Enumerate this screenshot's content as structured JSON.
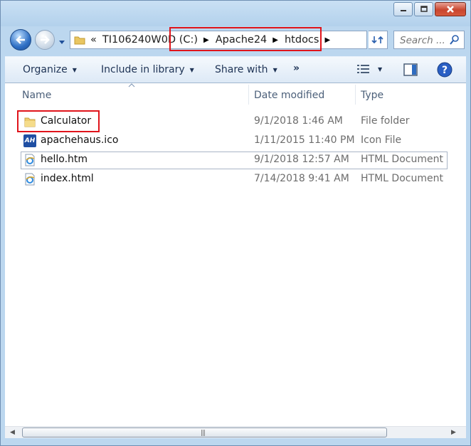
{
  "window": {
    "buttons": {
      "minimize": "minimize",
      "maximize": "maximize",
      "close": "close"
    }
  },
  "address": {
    "overflow_glyph": "«",
    "crumbs": [
      "TI106240W0D (C:)",
      "Apache24",
      "htdocs"
    ]
  },
  "search": {
    "placeholder": "Search ..."
  },
  "toolbar": {
    "organize": "Organize",
    "include_in_library": "Include in library",
    "share_with": "Share with",
    "more": "»"
  },
  "columns": {
    "name": "Name",
    "date_modified": "Date modified",
    "type": "Type"
  },
  "files": [
    {
      "name": "Calculator",
      "date": "9/1/2018 1:46 AM",
      "type": "File folder",
      "icon": "folder-icon"
    },
    {
      "name": "apachehaus.ico",
      "date": "1/11/2015 11:40 PM",
      "type": "Icon File",
      "icon": "apachehaus-icon",
      "icon_text": "AH"
    },
    {
      "name": "hello.htm",
      "date": "9/1/2018 12:57 AM",
      "type": "HTML Document",
      "icon": "ie-document-icon"
    },
    {
      "name": "index.html",
      "date": "7/14/2018 9:41 AM",
      "type": "HTML Document",
      "icon": "ie-document-icon"
    }
  ],
  "colors": {
    "highlight": "#e0141b",
    "window_frame": "#bcd7ef",
    "toolbar_text": "#1e3355"
  }
}
